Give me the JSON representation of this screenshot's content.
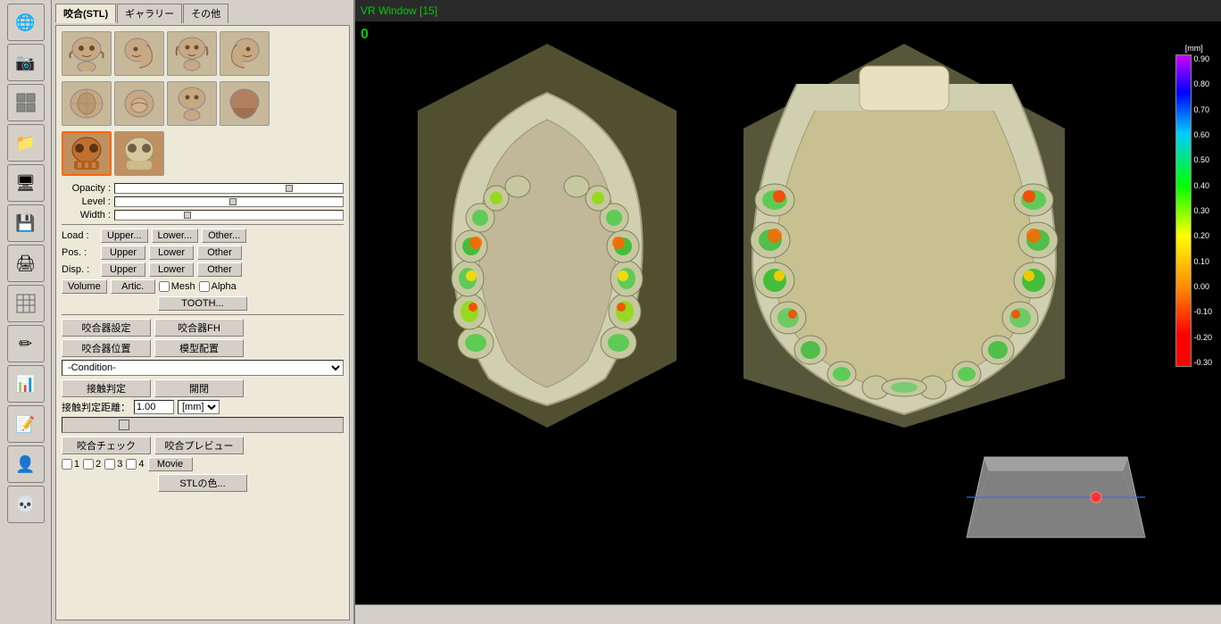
{
  "titlebar": {
    "text": "VR Window [15]"
  },
  "sidebar": {
    "icons": [
      {
        "name": "globe-icon",
        "glyph": "🌐"
      },
      {
        "name": "camera-icon",
        "glyph": "📷"
      },
      {
        "name": "grid-icon",
        "glyph": "⊞"
      },
      {
        "name": "folder-icon",
        "glyph": "📁"
      },
      {
        "name": "monitor-icon",
        "glyph": "🖥"
      },
      {
        "name": "save-icon",
        "glyph": "💾"
      },
      {
        "name": "print-icon",
        "glyph": "🖨"
      },
      {
        "name": "table-icon",
        "glyph": "▦"
      },
      {
        "name": "edit-icon",
        "glyph": "✏"
      },
      {
        "name": "chart-icon",
        "glyph": "📊"
      },
      {
        "name": "note-icon",
        "glyph": "📝"
      },
      {
        "name": "person-icon",
        "glyph": "👤"
      },
      {
        "name": "skull-icon",
        "glyph": "💀"
      }
    ]
  },
  "tabs": [
    {
      "id": "tab-bite",
      "label": "咬合(STL)",
      "active": true
    },
    {
      "id": "tab-gallery",
      "label": "ギャラリー"
    },
    {
      "id": "tab-other",
      "label": "その他"
    }
  ],
  "sliders": {
    "opacity": {
      "label": "Opacity :"
    },
    "level": {
      "label": "Level :"
    },
    "width": {
      "label": "Width :"
    }
  },
  "load_row": {
    "label": "Load :",
    "upper": "Upper...",
    "lower": "Lower...",
    "other": "Other..."
  },
  "pos_row": {
    "label": "Pos. :",
    "upper": "Upper",
    "lower": "Lower",
    "other": "Other"
  },
  "disp_row": {
    "label": "Disp. :",
    "upper": "Upper",
    "lower": "Lower",
    "other": "Other"
  },
  "volume_row": {
    "volume": "Volume",
    "artic": "Artic.",
    "mesh": "Mesh",
    "alpha": "Alpha"
  },
  "tooth_btn": "TOOTH...",
  "buttons": {
    "bite_setting": "咬合器設定",
    "bite_fh": "咬合器FH",
    "bite_pos": "咬合器位置",
    "model_place": "模型配置",
    "condition": "-Condition-",
    "contact_judge": "接触判定",
    "open": "開閉",
    "contact_dist": "接触判定距離：",
    "dist_value": "1.00",
    "dist_unit": "[mm]",
    "bite_check": "咬合チェック",
    "bite_preview": "咬合プレビュー",
    "stl_color": "STLの色...",
    "movie": "Movie"
  },
  "checkboxes": {
    "ch1": "1",
    "ch2": "2",
    "ch3": "3",
    "ch4": "4"
  },
  "vr_title": "VR Window [15]",
  "vr_number": "0",
  "scale": {
    "unit": "[mm]",
    "values": [
      "0.90",
      "0.80",
      "0.70",
      "0.60",
      "0.50",
      "0.40",
      "0.30",
      "0.20",
      "0.10",
      "0.00",
      "-0.10",
      "-0.20",
      "-0.30"
    ]
  }
}
